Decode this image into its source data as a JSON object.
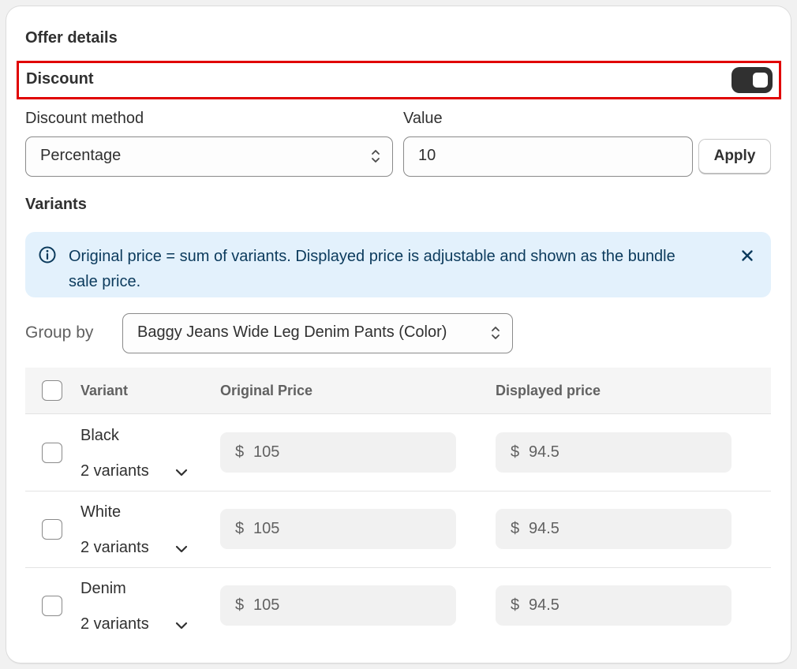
{
  "offer_details": {
    "title": "Offer details",
    "discount": {
      "label": "Discount",
      "enabled": true
    },
    "discount_method": {
      "label": "Discount method",
      "value": "Percentage"
    },
    "value_field": {
      "label": "Value",
      "value": "10"
    },
    "apply_label": "Apply"
  },
  "variants_section": {
    "title": "Variants",
    "banner_text": "Original price = sum of variants. Displayed price is adjustable and shown as the bundle sale price.",
    "group_by": {
      "label": "Group by",
      "value": "Baggy Jeans Wide Leg Denim Pants (Color)"
    },
    "table": {
      "headers": {
        "variant": "Variant",
        "original_price": "Original Price",
        "displayed_price": "Displayed price"
      },
      "currency_symbol": "$",
      "rows": [
        {
          "name": "Black",
          "variants_text": "2 variants",
          "original_price": "105",
          "displayed_price": "94.5"
        },
        {
          "name": "White",
          "variants_text": "2 variants",
          "original_price": "105",
          "displayed_price": "94.5"
        },
        {
          "name": "Denim",
          "variants_text": "2 variants",
          "original_price": "105",
          "displayed_price": "94.5"
        }
      ]
    }
  },
  "colors": {
    "highlight_border": "#e00000",
    "toggle_on": "#303030",
    "banner_bg": "#e3f1fc",
    "banner_text": "#0b3a5c"
  },
  "icons": {
    "select_chevron": "chevron-up-down-icon",
    "banner_info": "info-circle-icon",
    "banner_close": "close-icon",
    "row_expand": "chevron-down-icon"
  }
}
